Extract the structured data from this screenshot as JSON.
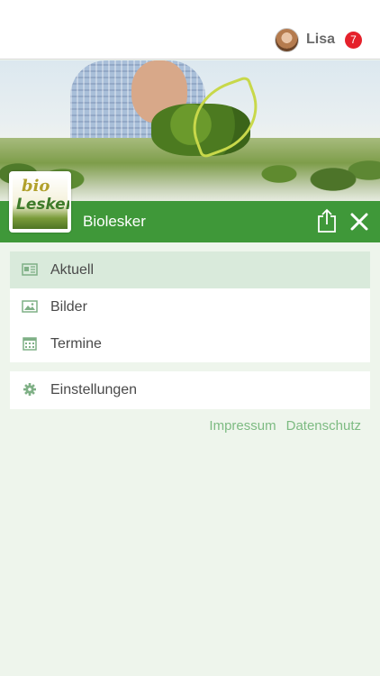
{
  "header": {
    "user_name": "Lisa",
    "notification_count": "7"
  },
  "brand": {
    "logo_text_top": "bio",
    "logo_text_bottom": "Lesker",
    "title": "Biolesker",
    "accent_color": "#3f9839"
  },
  "menu": {
    "items": [
      {
        "label": "Aktuell",
        "icon": "news-icon",
        "active": true
      },
      {
        "label": "Bilder",
        "icon": "image-icon",
        "active": false
      },
      {
        "label": "Termine",
        "icon": "calendar-icon",
        "active": false
      }
    ],
    "settings": {
      "label": "Einstellungen",
      "icon": "gear-icon"
    }
  },
  "footer": {
    "impressum": "Impressum",
    "datenschutz": "Datenschutz"
  }
}
